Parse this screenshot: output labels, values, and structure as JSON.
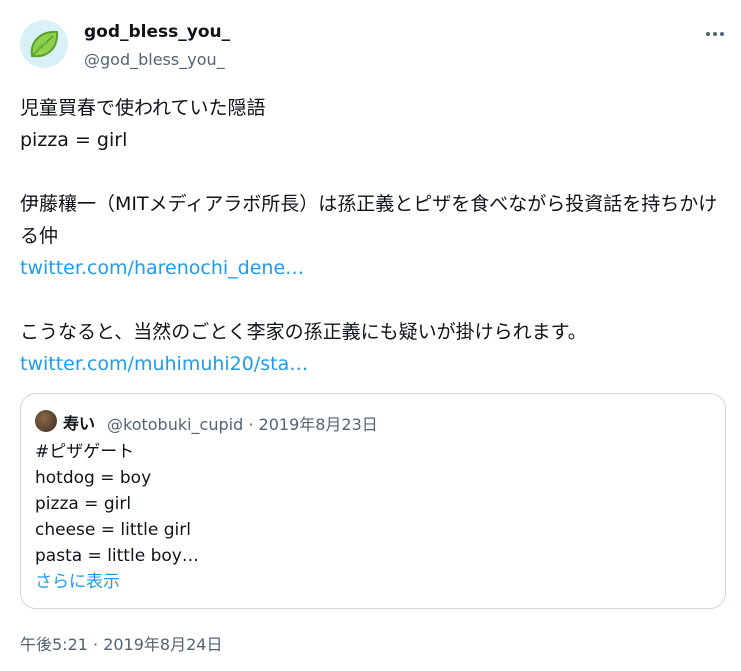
{
  "author": {
    "display_name": "god_bless_you_",
    "handle": "@god_bless_you_",
    "avatar_icon": "leaf-icon"
  },
  "more_icon": "more-options-icon",
  "tweet": {
    "lines": [
      "児童買春で使われていた隠語",
      "pizza = girl",
      "",
      "伊藤穰一（MITメディアラボ所長）は孫正義とピザを食べながら投資話を持ちかける仲",
      "twitter.com/harenochi_dene…",
      "",
      "こうなると、当然のごとく李家の孫正義にも疑いが掛けられます。",
      "twitter.com/muhimuhi20/sta…"
    ]
  },
  "quoted_tweet": {
    "display_name": "寿い",
    "handle": "@kotobuki_cupid",
    "separator": "·",
    "date": "2019年8月23日",
    "lines": [
      "#ピザゲート",
      "hotdog = boy",
      "pizza = girl",
      "cheese = little girl",
      "pasta = little boy…"
    ],
    "show_more": "さらに表示"
  },
  "timestamp": "午後5:21 · 2019年8月24日",
  "colors": {
    "link": "#1d9bf0",
    "text": "#0f1419",
    "secondary": "#536471",
    "border": "#cfd9de"
  }
}
